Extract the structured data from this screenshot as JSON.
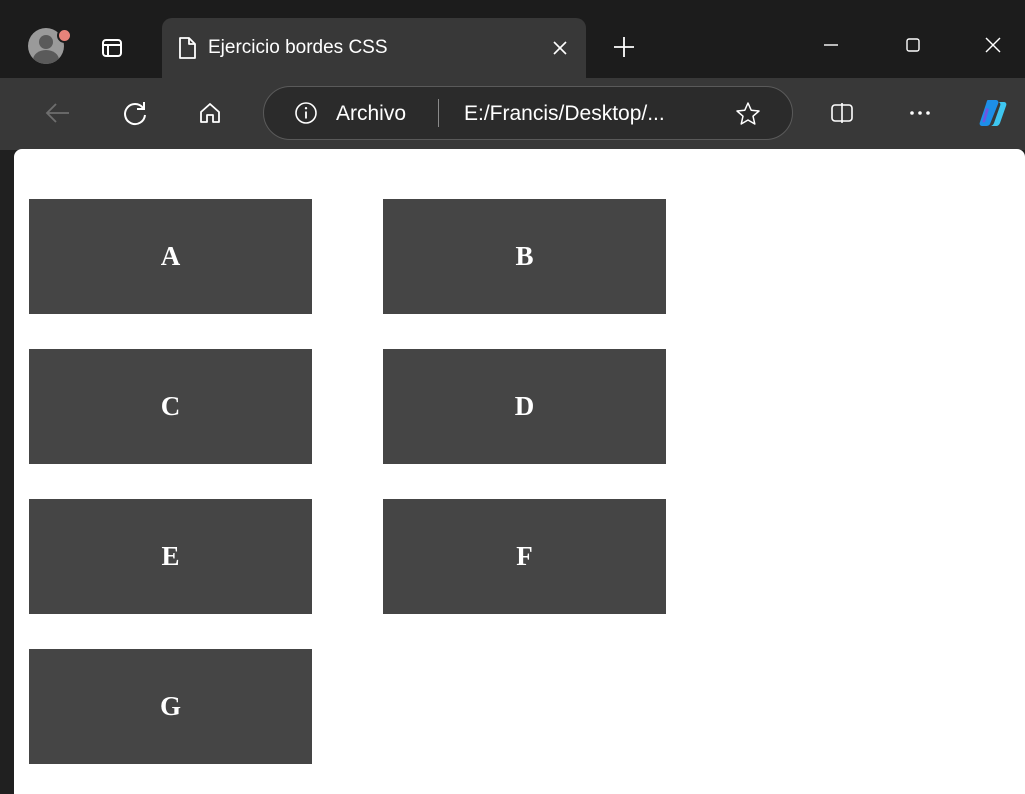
{
  "browser": {
    "tab": {
      "title": "Ejercicio bordes CSS"
    },
    "address_bar": {
      "site_label": "Archivo",
      "url": "E:/Francis/Desktop/..."
    },
    "icons": {
      "profile": "avatar-icon",
      "tab_actions": "tab-actions-icon",
      "page": "page-icon",
      "close_tab": "close-icon",
      "new_tab": "plus-icon",
      "minimize": "minimize-icon",
      "maximize": "maximize-icon",
      "close_window": "close-window-icon",
      "back": "back-arrow-icon",
      "refresh": "refresh-icon",
      "home": "home-icon",
      "info": "info-icon",
      "favorite": "star-icon",
      "split_screen": "split-screen-icon",
      "more": "more-icon",
      "copilot": "copilot-icon"
    },
    "colors": {
      "chrome_dark": "#1c1c1c",
      "chrome_mid": "#383838",
      "box_fill": "#454545",
      "box_text": "#ffffff",
      "page_bg": "#ffffff"
    }
  },
  "page": {
    "boxes": [
      "A",
      "B",
      "C",
      "D",
      "E",
      "F",
      "G"
    ]
  }
}
